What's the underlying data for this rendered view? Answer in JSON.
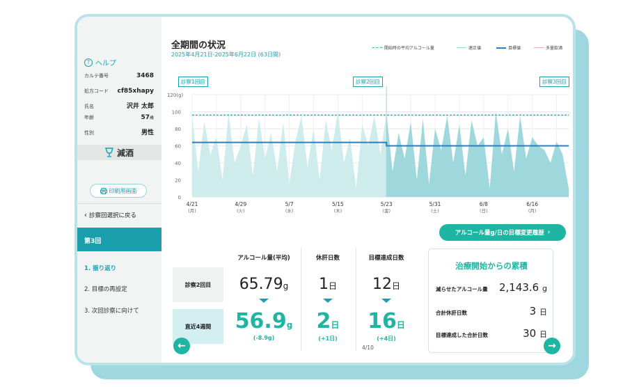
{
  "sidebar": {
    "help_label": "ヘルプ",
    "karte_label": "カルテ番号",
    "karte_value": "3468",
    "rx_label": "処方コード",
    "rx_value": "cf85xhapy",
    "name_label": "氏名",
    "name_value": "沢井 太郎",
    "age_label": "年齢",
    "age_value": "57",
    "age_unit": "歳",
    "sex_label": "性別",
    "sex_value": "男性",
    "brand_label": "減酒",
    "print_label": "印刷用画面",
    "back_label": "診察回選択に戻る",
    "visit_label": "第3回",
    "steps": [
      "1. 振り返り",
      "2. 目標の再設定",
      "3. 次回診察に向けて"
    ]
  },
  "header": {
    "title": "全期間の状況",
    "subtitle": "2025年4月21日-2025年6月22日 (63日間)",
    "legend": [
      "開始時の平均アルコール量",
      "適正値",
      "目標値",
      "多量飲酒"
    ]
  },
  "markers": [
    "診察1回目",
    "診察2回目",
    "診察3回目"
  ],
  "chart_data": {
    "type": "area",
    "ylabel_unit": "120(g)",
    "ylim": [
      0,
      120
    ],
    "yticks": [
      "120(g)",
      "100",
      "80",
      "60",
      "40",
      "20",
      "0"
    ],
    "xticks": [
      {
        "date": "4/21",
        "dow": "(月)"
      },
      {
        "date": "4/29",
        "dow": "(火)"
      },
      {
        "date": "5/7",
        "dow": "(水)"
      },
      {
        "date": "5/15",
        "dow": "(木)"
      },
      {
        "date": "5/23",
        "dow": "(金)"
      },
      {
        "date": "5/31",
        "dow": "(土)"
      },
      {
        "date": "6/8",
        "dow": "(日)"
      },
      {
        "date": "6/16",
        "dow": "(月)"
      }
    ],
    "daily_alcohol_g": [
      95,
      30,
      88,
      50,
      70,
      20,
      98,
      40,
      60,
      85,
      25,
      92,
      45,
      75,
      30,
      88,
      15,
      65,
      95,
      35,
      80,
      20,
      90,
      55,
      100,
      40,
      70,
      10,
      85,
      60,
      95,
      50,
      98,
      30,
      75,
      45,
      88,
      20,
      92,
      15,
      80,
      55,
      95,
      40,
      85,
      25,
      90,
      60,
      70,
      10,
      100,
      50,
      80,
      30,
      95,
      45,
      70,
      60,
      55,
      40,
      65,
      50,
      10
    ],
    "baseline_avg": 96,
    "goal_period1": 64,
    "goal_period2": 60,
    "goal_change_day": 32,
    "grid": true
  },
  "goal_button_label": "アルコール量g/日の目標変更履歴",
  "stats": {
    "columns": [
      "アルコール量(平均)",
      "休肝日数",
      "目標達成日数"
    ],
    "rows": [
      {
        "label": "診察2回目",
        "values": [
          "65.79",
          "1",
          "12"
        ],
        "units": [
          "g",
          "日",
          "日"
        ]
      },
      {
        "label": "直近4週間",
        "values": [
          "56.9",
          "2",
          "16"
        ],
        "units": [
          "g",
          "日",
          "日"
        ],
        "deltas": [
          "(-8.9g)",
          "(+1日)",
          "(+4日)"
        ]
      }
    ]
  },
  "cumulative": {
    "title": "治療開始からの累積",
    "rows": [
      {
        "label": "減らせたアルコール量",
        "value": "2,143.6",
        "unit": "g"
      },
      {
        "label": "合計休肝日数",
        "value": "3",
        "unit": "日"
      },
      {
        "label": "目標達成した合計日数",
        "value": "30",
        "unit": "日"
      }
    ]
  },
  "pagination": "4/10"
}
